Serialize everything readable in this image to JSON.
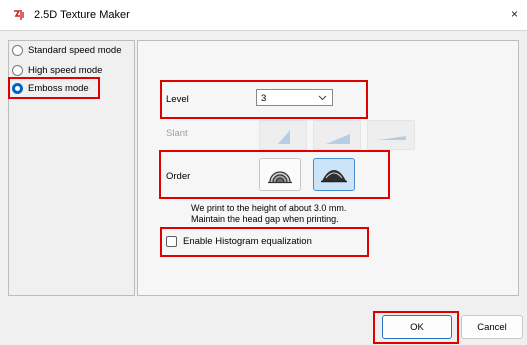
{
  "window": {
    "title": "2.5D Texture Maker",
    "close_glyph": "×",
    "icon": "app-icon"
  },
  "modes": {
    "items": [
      {
        "label": "Standard speed mode",
        "selected": false
      },
      {
        "label": "High speed mode",
        "selected": false
      },
      {
        "label": "Emboss mode",
        "selected": true
      }
    ]
  },
  "settings": {
    "level_label": "Level",
    "level_value": "3",
    "slant_label": "Slant",
    "order_label": "Order",
    "order_selected_index": 1,
    "note_line1": "We print to the height of about 3.0 mm.",
    "note_line2": "Maintain the head gap when printing.",
    "histogram_label": "Enable Histogram equalization",
    "histogram_checked": false
  },
  "buttons": {
    "ok": "OK",
    "cancel": "Cancel"
  },
  "colors": {
    "highlight_box": "#e00000",
    "selected_radio": "#0067c0",
    "selected_button_bg": "#cce4f7"
  }
}
